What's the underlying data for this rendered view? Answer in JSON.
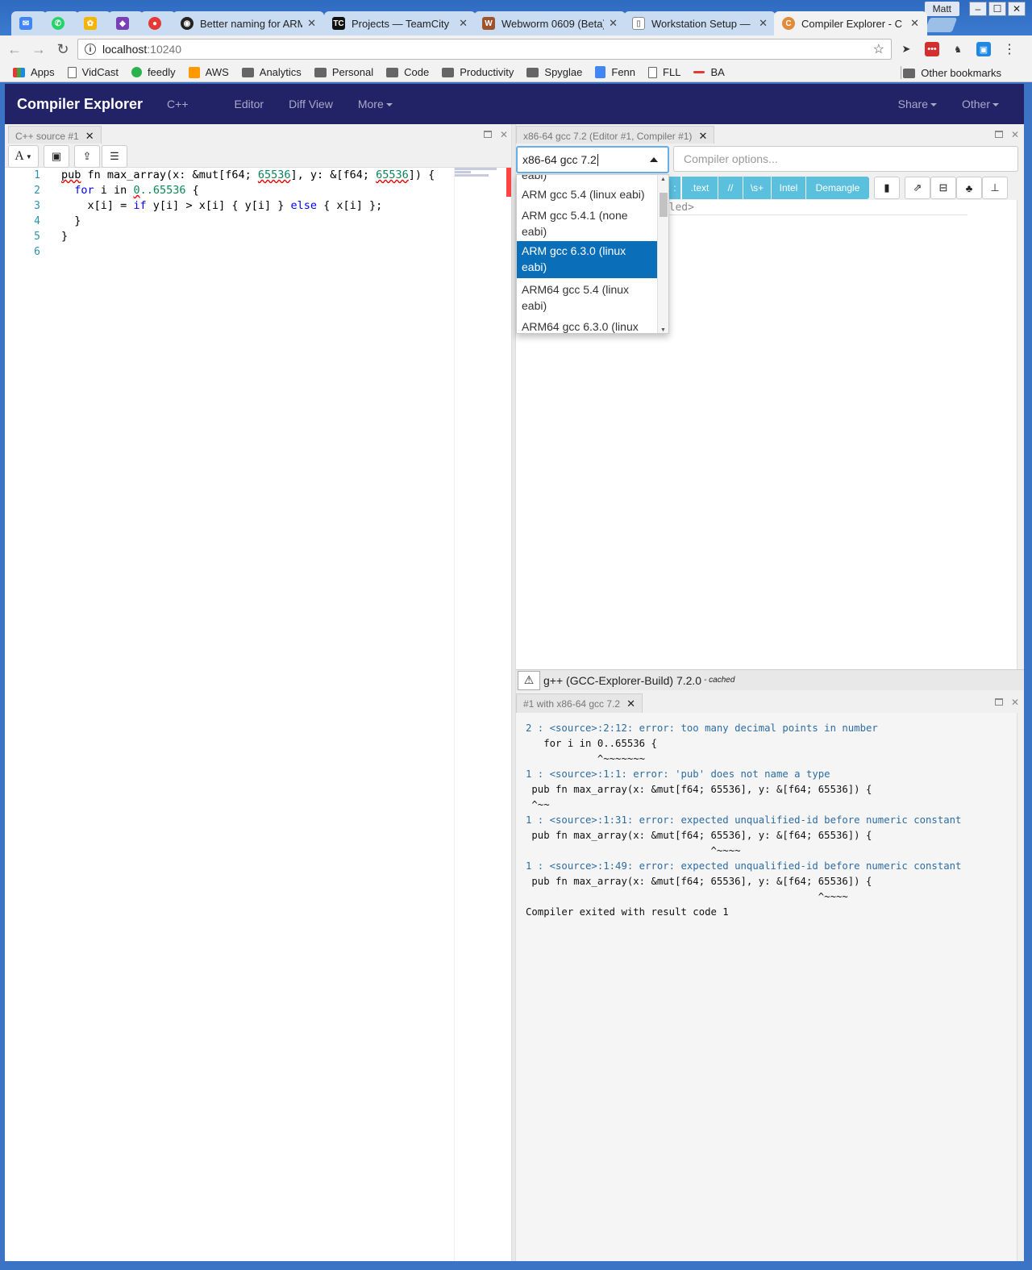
{
  "browser": {
    "tabs": [
      {
        "label": "",
        "icon": "inbox-icon",
        "color": "#4285f4"
      },
      {
        "label": "",
        "icon": "whatsapp-icon",
        "color": "#25d366"
      },
      {
        "label": "",
        "icon": "keep-icon",
        "color": "#f4b400"
      },
      {
        "label": "",
        "icon": "ext-icon",
        "color": "#7a3fb5"
      },
      {
        "label": "",
        "icon": "record-icon",
        "color": "#e53935"
      },
      {
        "label": "Better naming for ARM",
        "icon": "github-icon",
        "color": "#222222"
      },
      {
        "label": "Projects — TeamCity",
        "icon": "teamcity-icon",
        "color": "#111111"
      },
      {
        "label": "Webworm 0609 (Beta)",
        "icon": "webworm-icon",
        "color": "#a0522d"
      },
      {
        "label": "Workstation Setup —",
        "icon": "page-icon",
        "color": "#999999"
      },
      {
        "label": "Compiler Explorer - C",
        "icon": "ce-icon",
        "color": "#e08a3a"
      }
    ],
    "profile": "Matt",
    "url_host": "localhost",
    "url_port": ":10240",
    "bookmarks": [
      {
        "label": "Apps",
        "icon": "apps-icon"
      },
      {
        "label": "VidCast",
        "icon": "page-icon"
      },
      {
        "label": "feedly",
        "icon": "feedly-icon"
      },
      {
        "label": "AWS",
        "icon": "aws-icon"
      },
      {
        "label": "Analytics",
        "icon": "folder-icon"
      },
      {
        "label": "Personal",
        "icon": "folder-icon"
      },
      {
        "label": "Code",
        "icon": "folder-icon"
      },
      {
        "label": "Productivity",
        "icon": "folder-icon"
      },
      {
        "label": "Spyglae",
        "icon": "folder-icon"
      },
      {
        "label": "Fenn",
        "icon": "docs-icon"
      },
      {
        "label": "FLL",
        "icon": "page-icon"
      },
      {
        "label": "BA",
        "icon": "ba-icon"
      }
    ],
    "other_bookmarks": "Other bookmarks"
  },
  "app": {
    "brand": "Compiler Explorer",
    "nav": [
      "C++",
      "Editor",
      "Diff View",
      "More"
    ],
    "nav_right": [
      "Share",
      "Other"
    ]
  },
  "editor": {
    "tab_title": "C++ source #1",
    "font_btn": "A",
    "lines": [
      "1",
      "2",
      "3",
      "4",
      "5",
      "6"
    ],
    "code": {
      "l1_a": "pub",
      "l1_b": " fn max_array(x: &mut[f64; ",
      "l1_c": "65536",
      "l1_d": "], y: &[f64; ",
      "l1_e": "65536",
      "l1_f": "]) {",
      "l2_a": "  ",
      "l2_b": "for",
      "l2_c": " i in ",
      "l2_d": "0",
      "l2_e": "..65536",
      "l2_f": " {",
      "l3_a": "    x[i] = ",
      "l3_b": "if",
      "l3_c": " y[i] > x[i] { y[i] } ",
      "l3_d": "else",
      "l3_e": " { x[i] };",
      "l4": "  }",
      "l5": "}",
      "l6": ""
    }
  },
  "compiler": {
    "tab_title": "x86-64 gcc 7.2 (Editor #1, Compiler #1)",
    "selected": "x86-64 gcc 7.2",
    "options_placeholder": "Compiler options...",
    "filters": [
      ".text",
      "//",
      "\\s+",
      "Intel",
      "Demangle"
    ],
    "filter_hidden_first": ":",
    "asm_text": "ailed>",
    "dropdown": {
      "partial_top": "eabi)",
      "items": [
        {
          "line1": "ARM gcc 5.4 (linux eabi)",
          "line2": ""
        },
        {
          "line1": "ARM gcc 5.4.1 (none",
          "line2": "eabi)"
        },
        {
          "line1": "ARM gcc 6.3.0 (linux",
          "line2": "eabi)"
        },
        {
          "line1": "ARM64 gcc 5.4 (linux",
          "line2": "eabi)"
        },
        {
          "line1": "ARM64 gcc 6.3.0 (linux",
          "line2": ""
        }
      ],
      "selected_index": 2
    },
    "status": "g++ (GCC-Explorer-Build) 7.2.0",
    "status_suffix": "- cached"
  },
  "output": {
    "tab_title": "#1 with x86-64 gcc 7.2",
    "lines": [
      {
        "text": "2 : <source>:2:12: error: too many decimal points in number",
        "kind": "link"
      },
      {
        "text": "   for i in 0..65536 {",
        "kind": "plain"
      },
      {
        "text": "            ^~~~~~~~",
        "kind": "plain"
      },
      {
        "text": "1 : <source>:1:1: error: 'pub' does not name a type",
        "kind": "link"
      },
      {
        "text": " pub fn max_array(x: &mut[f64; 65536], y: &[f64; 65536]) {",
        "kind": "plain"
      },
      {
        "text": " ^~~",
        "kind": "plain"
      },
      {
        "text": "1 : <source>:1:31: error: expected unqualified-id before numeric constant",
        "kind": "link"
      },
      {
        "text": " pub fn max_array(x: &mut[f64; 65536], y: &[f64; 65536]) {",
        "kind": "plain"
      },
      {
        "text": "                               ^~~~~",
        "kind": "plain"
      },
      {
        "text": "1 : <source>:1:49: error: expected unqualified-id before numeric constant",
        "kind": "link"
      },
      {
        "text": " pub fn max_array(x: &mut[f64; 65536], y: &[f64; 65536]) {",
        "kind": "plain"
      },
      {
        "text": "                                                 ^~~~~",
        "kind": "plain"
      },
      {
        "text": "Compiler exited with result code 1",
        "kind": "plain"
      }
    ]
  }
}
